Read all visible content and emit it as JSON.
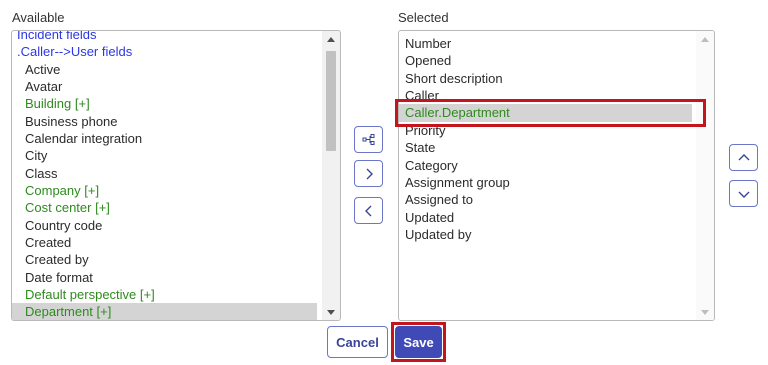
{
  "available": {
    "heading": "Available",
    "options": [
      {
        "label": "Incident fields",
        "color": "blue"
      },
      {
        "label": ".Caller-->User fields",
        "color": "blue"
      },
      {
        "label": "Active",
        "color": "dark"
      },
      {
        "label": "Avatar",
        "color": "dark"
      },
      {
        "label": "Building [+]",
        "color": "green"
      },
      {
        "label": "Business phone",
        "color": "dark"
      },
      {
        "label": "Calendar integration",
        "color": "dark"
      },
      {
        "label": "City",
        "color": "dark"
      },
      {
        "label": "Class",
        "color": "dark"
      },
      {
        "label": "Company [+]",
        "color": "green"
      },
      {
        "label": "Cost center [+]",
        "color": "green"
      },
      {
        "label": "Country code",
        "color": "dark"
      },
      {
        "label": "Created",
        "color": "dark"
      },
      {
        "label": "Created by",
        "color": "dark"
      },
      {
        "label": "Date format",
        "color": "dark"
      },
      {
        "label": "Default perspective [+]",
        "color": "green"
      },
      {
        "label": "Department [+]",
        "color": "green",
        "selected": true
      }
    ]
  },
  "selected": {
    "heading": "Selected",
    "options": [
      {
        "label": "Number"
      },
      {
        "label": "Opened"
      },
      {
        "label": "Short description"
      },
      {
        "label": "Caller"
      },
      {
        "label": "Caller.Department",
        "selected": true
      },
      {
        "label": "Priority"
      },
      {
        "label": "State"
      },
      {
        "label": "Category"
      },
      {
        "label": "Assignment group"
      },
      {
        "label": "Assigned to"
      },
      {
        "label": "Updated"
      },
      {
        "label": "Updated by"
      }
    ]
  },
  "icons": {
    "dot_walk": "dot-walk-icon",
    "add": "chevron-right-icon",
    "remove": "chevron-left-icon",
    "move_up": "chevron-up-icon",
    "move_down": "chevron-down-icon"
  },
  "buttons": {
    "cancel": "Cancel",
    "save": "Save"
  },
  "colors": {
    "link_blue": "#2a36e8",
    "reference_green": "#2e8b1e",
    "selection_grey": "#d4d4d4",
    "primary": "#3f4ab6",
    "annotation_red": "#c4141c"
  }
}
